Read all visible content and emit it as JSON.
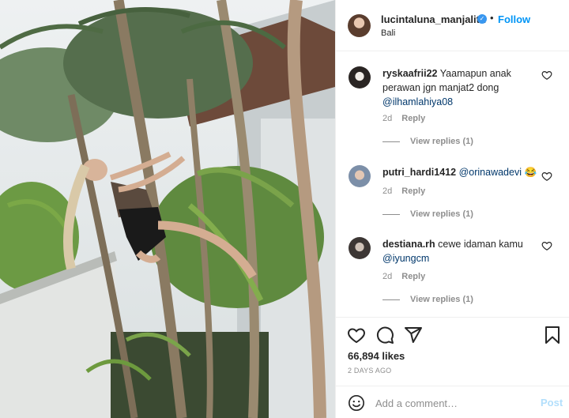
{
  "header": {
    "username": "lucintaluna_manjalita",
    "verified_icon": "✓",
    "separator": "•",
    "follow_label": "Follow",
    "location": "Bali"
  },
  "comments": [
    {
      "username": "ryskaafrii22",
      "text": "Yaamapun anak perawan jgn manjat2 dong",
      "mention": "@ilhamlahiya08",
      "age": "2d",
      "reply_label": "Reply",
      "view_replies": "View replies (1)"
    },
    {
      "username": "putri_hardi1412",
      "mention": "@orinawadevi",
      "emoji": "😂",
      "age": "2d",
      "reply_label": "Reply",
      "view_replies": "View replies (1)"
    },
    {
      "username": "destiana.rh",
      "text": "cewe idaman kamu",
      "mention": "@iyungcm",
      "age": "2d",
      "reply_label": "Reply",
      "view_replies": "View replies (1)"
    }
  ],
  "actions": {
    "likes": "66,894 likes",
    "time_ago": "2 DAYS AGO"
  },
  "add_comment": {
    "placeholder": "Add a comment…",
    "post_label": "Post"
  },
  "colors": {
    "accent": "#0095f6",
    "post_disabled": "#b2dffc",
    "mention": "#00376b",
    "muted": "#8e8e8e"
  }
}
